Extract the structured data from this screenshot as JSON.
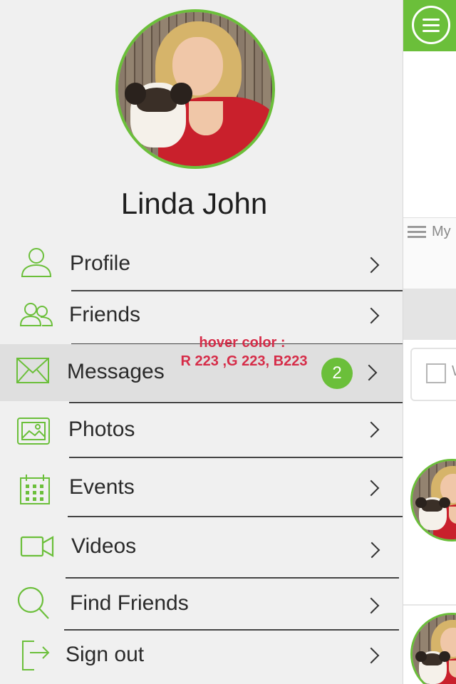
{
  "user": {
    "name": "Linda John"
  },
  "menu": [
    {
      "key": "profile",
      "label": "Profile",
      "icon": "user-icon"
    },
    {
      "key": "friends",
      "label": "Friends",
      "icon": "users-icon"
    },
    {
      "key": "messages",
      "label": "Messages",
      "icon": "envelope-icon",
      "badge": "2",
      "hovered": true
    },
    {
      "key": "photos",
      "label": "Photos",
      "icon": "image-icon"
    },
    {
      "key": "events",
      "label": "Events",
      "icon": "calendar-icon"
    },
    {
      "key": "videos",
      "label": "Videos",
      "icon": "video-camera-icon"
    },
    {
      "key": "find_friends",
      "label": "Find Friends",
      "icon": "search-icon"
    },
    {
      "key": "sign_out",
      "label": "Sign out",
      "icon": "sign-out-icon"
    }
  ],
  "annotation": {
    "line1": "hover color :",
    "line2": "R 223 ,G 223, B223"
  },
  "background_app": {
    "tab_label": "My"
  },
  "colors": {
    "accent": "#6bbf3a",
    "hover": "#dfdfdf",
    "drawer_bg": "#f0f0f0",
    "annotation": "#d62c48"
  }
}
